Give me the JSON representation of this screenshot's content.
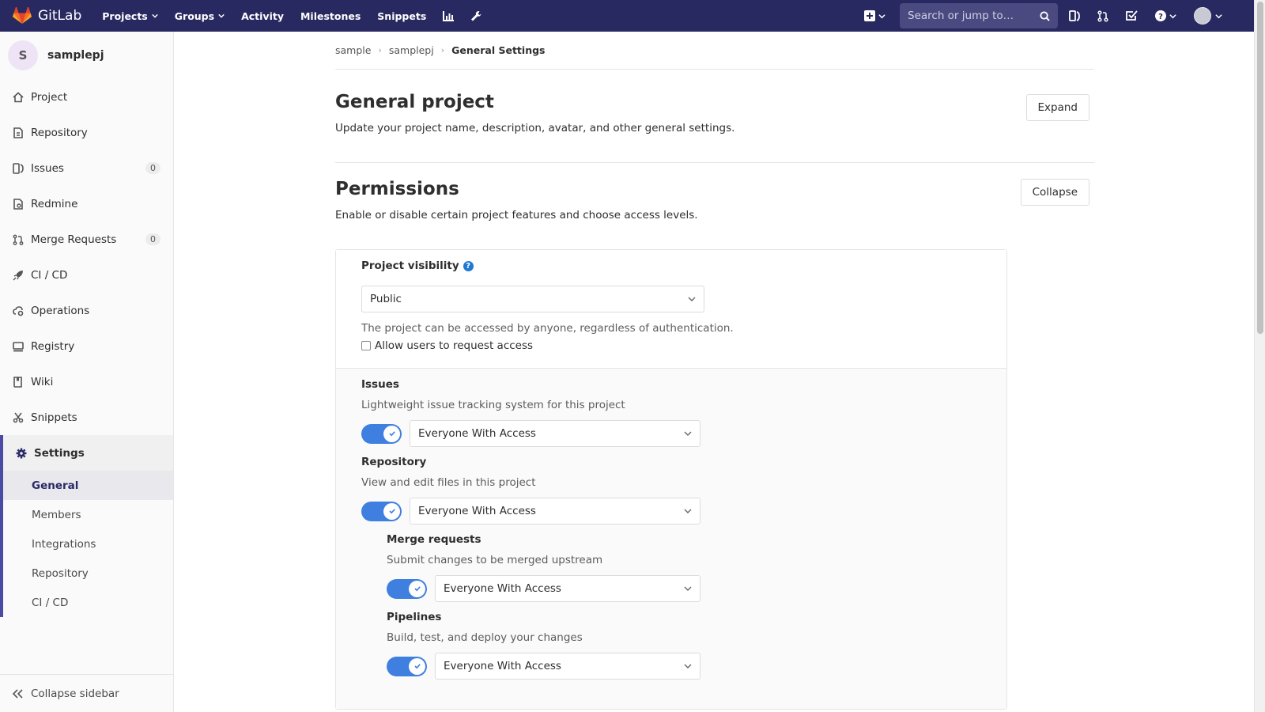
{
  "navbar": {
    "brand": "GitLab",
    "items": [
      {
        "label": "Projects",
        "dropdown": true
      },
      {
        "label": "Groups",
        "dropdown": true
      },
      {
        "label": "Activity",
        "dropdown": false
      },
      {
        "label": "Milestones",
        "dropdown": false
      },
      {
        "label": "Snippets",
        "dropdown": false
      }
    ],
    "search_placeholder": "Search or jump to…",
    "icons": [
      "chart-icon",
      "wrench-icon",
      "plus-square-icon",
      "issues-icon",
      "merge-request-icon",
      "todo-icon",
      "help-icon",
      "avatar"
    ]
  },
  "sidebar": {
    "project_initial": "S",
    "project_name": "samplepj",
    "items": [
      {
        "label": "Project",
        "icon": "home-icon"
      },
      {
        "label": "Repository",
        "icon": "doc-icon"
      },
      {
        "label": "Issues",
        "icon": "issues-icon",
        "badge": "0"
      },
      {
        "label": "Redmine",
        "icon": "redmine-icon"
      },
      {
        "label": "Merge Requests",
        "icon": "merge-request-icon",
        "badge": "0"
      },
      {
        "label": "CI / CD",
        "icon": "rocket-icon"
      },
      {
        "label": "Operations",
        "icon": "cloud-gear-icon"
      },
      {
        "label": "Registry",
        "icon": "disk-icon"
      },
      {
        "label": "Wiki",
        "icon": "book-icon"
      },
      {
        "label": "Snippets",
        "icon": "scissors-icon"
      }
    ],
    "settings": {
      "label": "Settings",
      "sub_items": [
        "General",
        "Members",
        "Integrations",
        "Repository",
        "CI / CD"
      ],
      "active": "General"
    },
    "collapse_label": "Collapse sidebar"
  },
  "breadcrumb": {
    "items": [
      "sample",
      "samplepj"
    ],
    "current": "General Settings"
  },
  "general": {
    "title": "General project",
    "description": "Update your project name, description, avatar, and other general settings.",
    "button": "Expand"
  },
  "permissions": {
    "title": "Permissions",
    "description": "Enable or disable certain project features and choose access levels.",
    "button": "Collapse",
    "visibility": {
      "label": "Project visibility",
      "value": "Public",
      "help": "The project can be accessed by anyone, regardless of authentication.",
      "checkbox_label": "Allow users to request access",
      "checkbox_checked": false
    },
    "features": [
      {
        "name": "Issues",
        "description": "Lightweight issue tracking system for this project",
        "access": "Everyone With Access",
        "enabled": true,
        "nested": false
      },
      {
        "name": "Repository",
        "description": "View and edit files in this project",
        "access": "Everyone With Access",
        "enabled": true,
        "nested": false
      },
      {
        "name": "Merge requests",
        "description": "Submit changes to be merged upstream",
        "access": "Everyone With Access",
        "enabled": true,
        "nested": true
      },
      {
        "name": "Pipelines",
        "description": "Build, test, and deploy your changes",
        "access": "Everyone With Access",
        "enabled": true,
        "nested": true
      }
    ]
  },
  "colors": {
    "navbar": "#292961",
    "accent": "#3f7fe0",
    "settings_border": "#4b4ba3"
  }
}
